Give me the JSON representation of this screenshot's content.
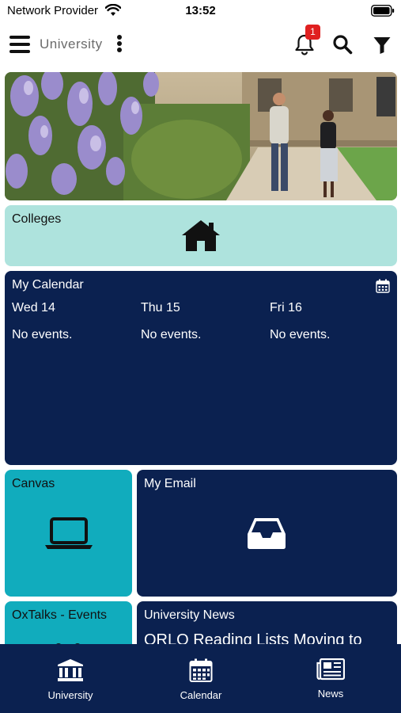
{
  "status_bar": {
    "carrier": "Network Provider",
    "time": "13:52",
    "wifi_icon": "wifi-icon",
    "battery_icon": "battery-icon"
  },
  "header": {
    "title": "University",
    "menu_icon": "hamburger-icon",
    "more_icon": "kebab-icon",
    "notification_count": "1",
    "icons": [
      "bell-icon",
      "search-icon",
      "filter-icon"
    ]
  },
  "tiles": {
    "hero": {
      "image": "campus-photo"
    },
    "colleges": {
      "label": "Colleges",
      "icon": "house-icon"
    },
    "calendar": {
      "label": "My Calendar",
      "icon": "calendar-icon",
      "days": [
        {
          "day": "Wed 14",
          "events": "No events."
        },
        {
          "day": "Thu 15",
          "events": "No events."
        },
        {
          "day": "Fri 16",
          "events": "No events."
        }
      ]
    },
    "canvas": {
      "label": "Canvas",
      "icon": "laptop-icon"
    },
    "email": {
      "label": "My Email",
      "icon": "inbox-icon"
    },
    "oxtalks": {
      "label": "OxTalks - Events"
    },
    "news": {
      "label": "University News",
      "headline": "ORLO Reading Lists Moving to"
    }
  },
  "bottom_nav": {
    "items": [
      {
        "label": "University",
        "icon": "university-building-icon"
      },
      {
        "label": "Calendar",
        "icon": "calendar-icon"
      },
      {
        "label": "News",
        "icon": "newspaper-icon"
      }
    ]
  },
  "colors": {
    "navy": "#0b2150",
    "teal": "#11acbd",
    "mint": "#aee3dd",
    "badge_red": "#e02020"
  }
}
